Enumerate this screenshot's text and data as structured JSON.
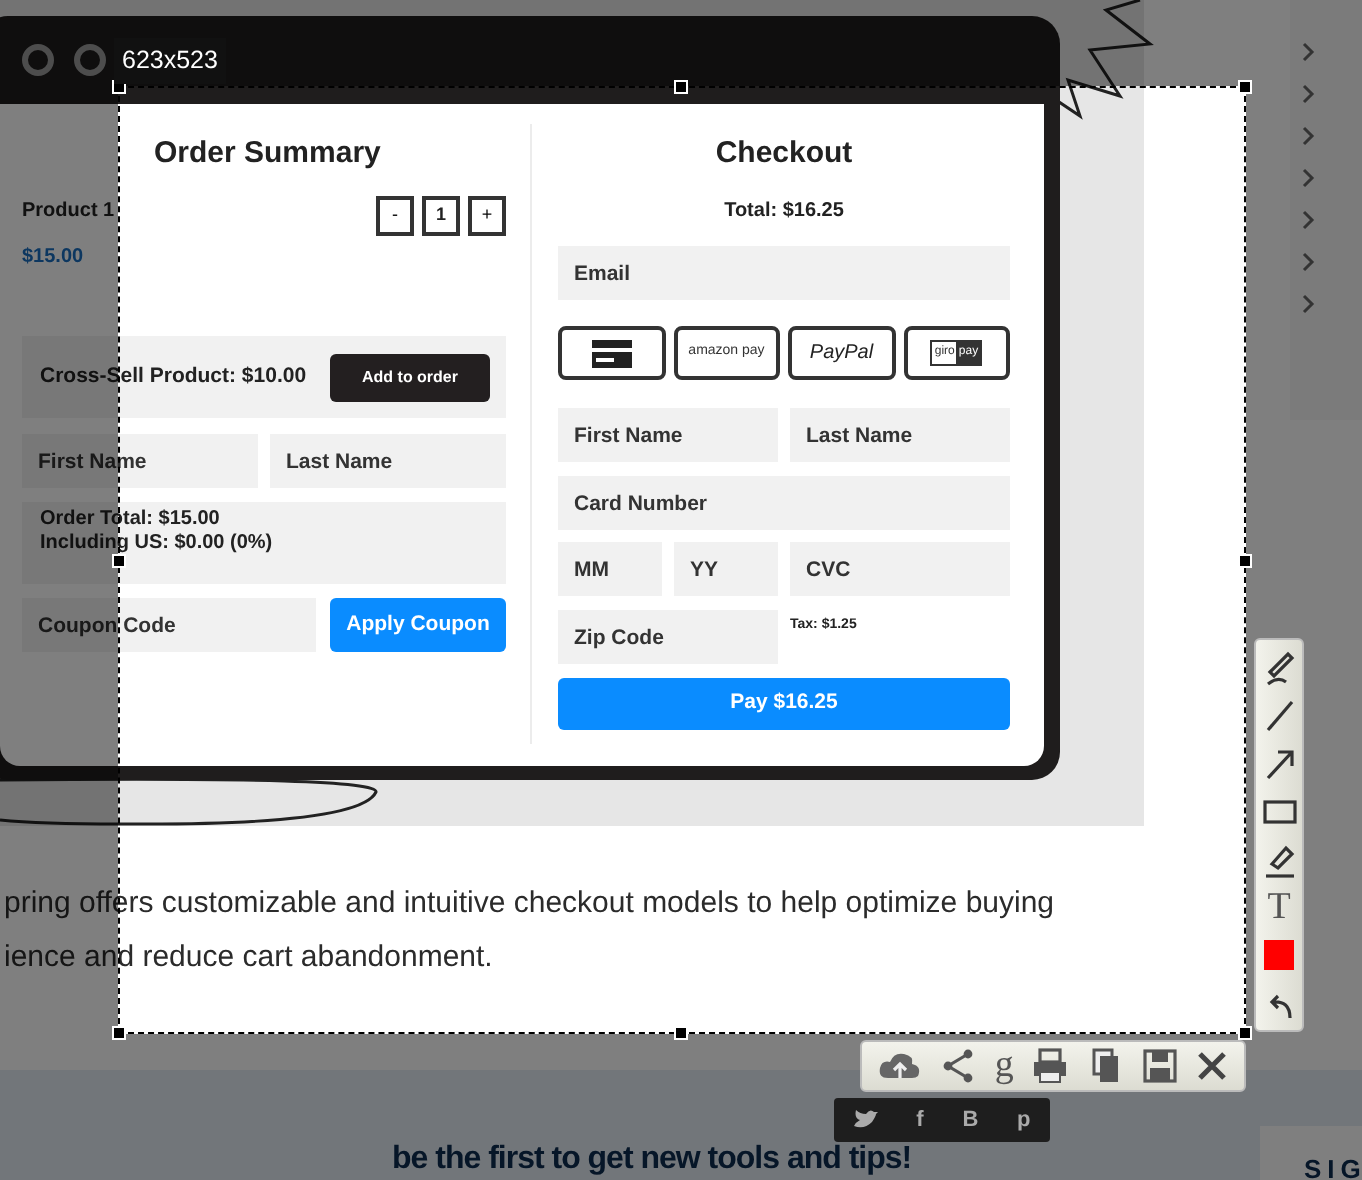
{
  "mockup": {
    "order_summary": {
      "title": "Order Summary",
      "product_name": "Product 1",
      "product_price": "$15.00",
      "quantity": {
        "minus": "-",
        "value": "1",
        "plus": "+"
      },
      "cross_sell": {
        "label": "Cross-Sell Product: $10.00",
        "button": "Add to order"
      },
      "name_fields": [
        {
          "placeholder": "First Name"
        },
        {
          "placeholder": "Last Name"
        }
      ],
      "order_total": [
        "Order Total: $15.00",
        "Including US: $0.00 (0%)"
      ],
      "coupon": {
        "placeholder": "Coupon Code",
        "button": "Apply Coupon"
      }
    },
    "checkout": {
      "title": "Checkout",
      "total": "Total: $16.25",
      "email": {
        "placeholder": "Email"
      },
      "payment_methods": [
        {
          "kind": "card"
        },
        {
          "kind": "amazon",
          "label": "amazon pay"
        },
        {
          "kind": "paypal",
          "label": "PayPal"
        },
        {
          "kind": "giropay",
          "label_parts": [
            "giro",
            "pay"
          ]
        }
      ],
      "name_fields": [
        {
          "placeholder": "First Name"
        },
        {
          "placeholder": "Last Name"
        }
      ],
      "card_number": {
        "placeholder": "Card Number"
      },
      "expiry_fields": [
        {
          "placeholder": "MM"
        },
        {
          "placeholder": "YY"
        },
        {
          "placeholder": "CVC"
        }
      ],
      "zip": {
        "placeholder": "Zip Code"
      },
      "tax": "Tax: $1.25",
      "pay_button": "Pay $16.25"
    }
  },
  "article": {
    "paragraph_lines": [
      "pring offers customizable and intuitive checkout models to help optimize buying",
      "ience and reduce cart abandonment."
    ]
  },
  "newsletter": {
    "heading": "be the first to get new tools and tips!",
    "signup_partial": "SIG"
  },
  "capture_tool": {
    "size_label": "623x523",
    "text_tool": "T",
    "google_tool": "g",
    "share_options": [
      {
        "kind": "twitter"
      },
      {
        "kind": "facebook",
        "glyph": "f"
      },
      {
        "kind": "blogger",
        "glyph": "B"
      },
      {
        "kind": "pinterest",
        "glyph": "p"
      }
    ]
  }
}
